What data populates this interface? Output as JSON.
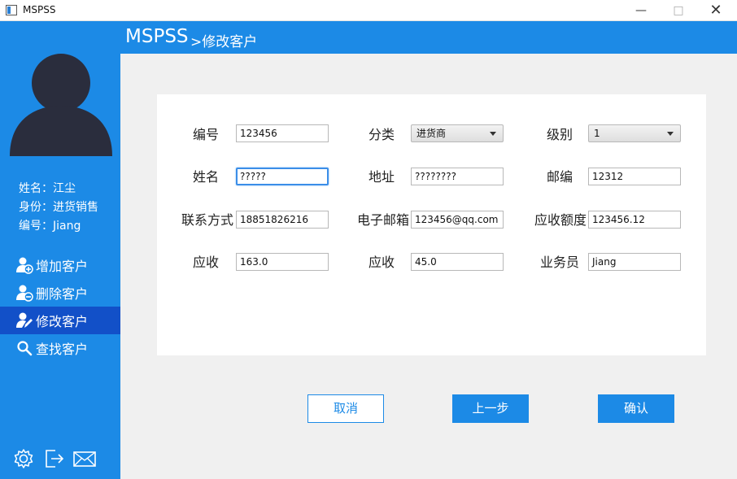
{
  "window": {
    "title": "MSPSS",
    "minimize_glyph": "—",
    "maximize_glyph": "□",
    "close_glyph": "✕"
  },
  "header": {
    "brand": "MSPSS",
    "breadcrumb": ">修改客户"
  },
  "user": {
    "name_line": "姓名：江尘",
    "role_line": "身份：进货销售",
    "id_line": "编号：Jiang"
  },
  "nav": [
    {
      "label": "增加客户",
      "icon": "user-add-icon",
      "active": false
    },
    {
      "label": "删除客户",
      "icon": "user-remove-icon",
      "active": false
    },
    {
      "label": "修改客户",
      "icon": "user-edit-icon",
      "active": true
    },
    {
      "label": "查找客户",
      "icon": "search-icon",
      "active": false
    }
  ],
  "bottom_icons": [
    "settings-icon",
    "logout-icon",
    "mail-icon"
  ],
  "form": {
    "id_label": "编号",
    "id_value": "123456",
    "category_label": "分类",
    "category_value": "进货商",
    "level_label": "级别",
    "level_value": "1",
    "name_label": "姓名",
    "name_value": "?????",
    "address_label": "地址",
    "address_value": "????????",
    "zip_label": "邮编",
    "zip_value": "12312",
    "phone_label": "联系方式",
    "phone_value": "18851826216",
    "email_label": "电子邮箱",
    "email_value": "123456@qq.com",
    "receivable_limit_label": "应收额度",
    "receivable_limit_value": "123456.12",
    "receivable_label": "应收",
    "receivable_value": "163.0",
    "payable_label": "应收",
    "payable_value": "45.0",
    "salesman_label": "业务员",
    "salesman_value": "Jiang"
  },
  "buttons": {
    "cancel": "取消",
    "previous": "上一步",
    "confirm": "确认"
  },
  "colors": {
    "primary": "#1c8ae6",
    "active_nav": "#1250c8",
    "avatar": "#2a2d3d"
  }
}
